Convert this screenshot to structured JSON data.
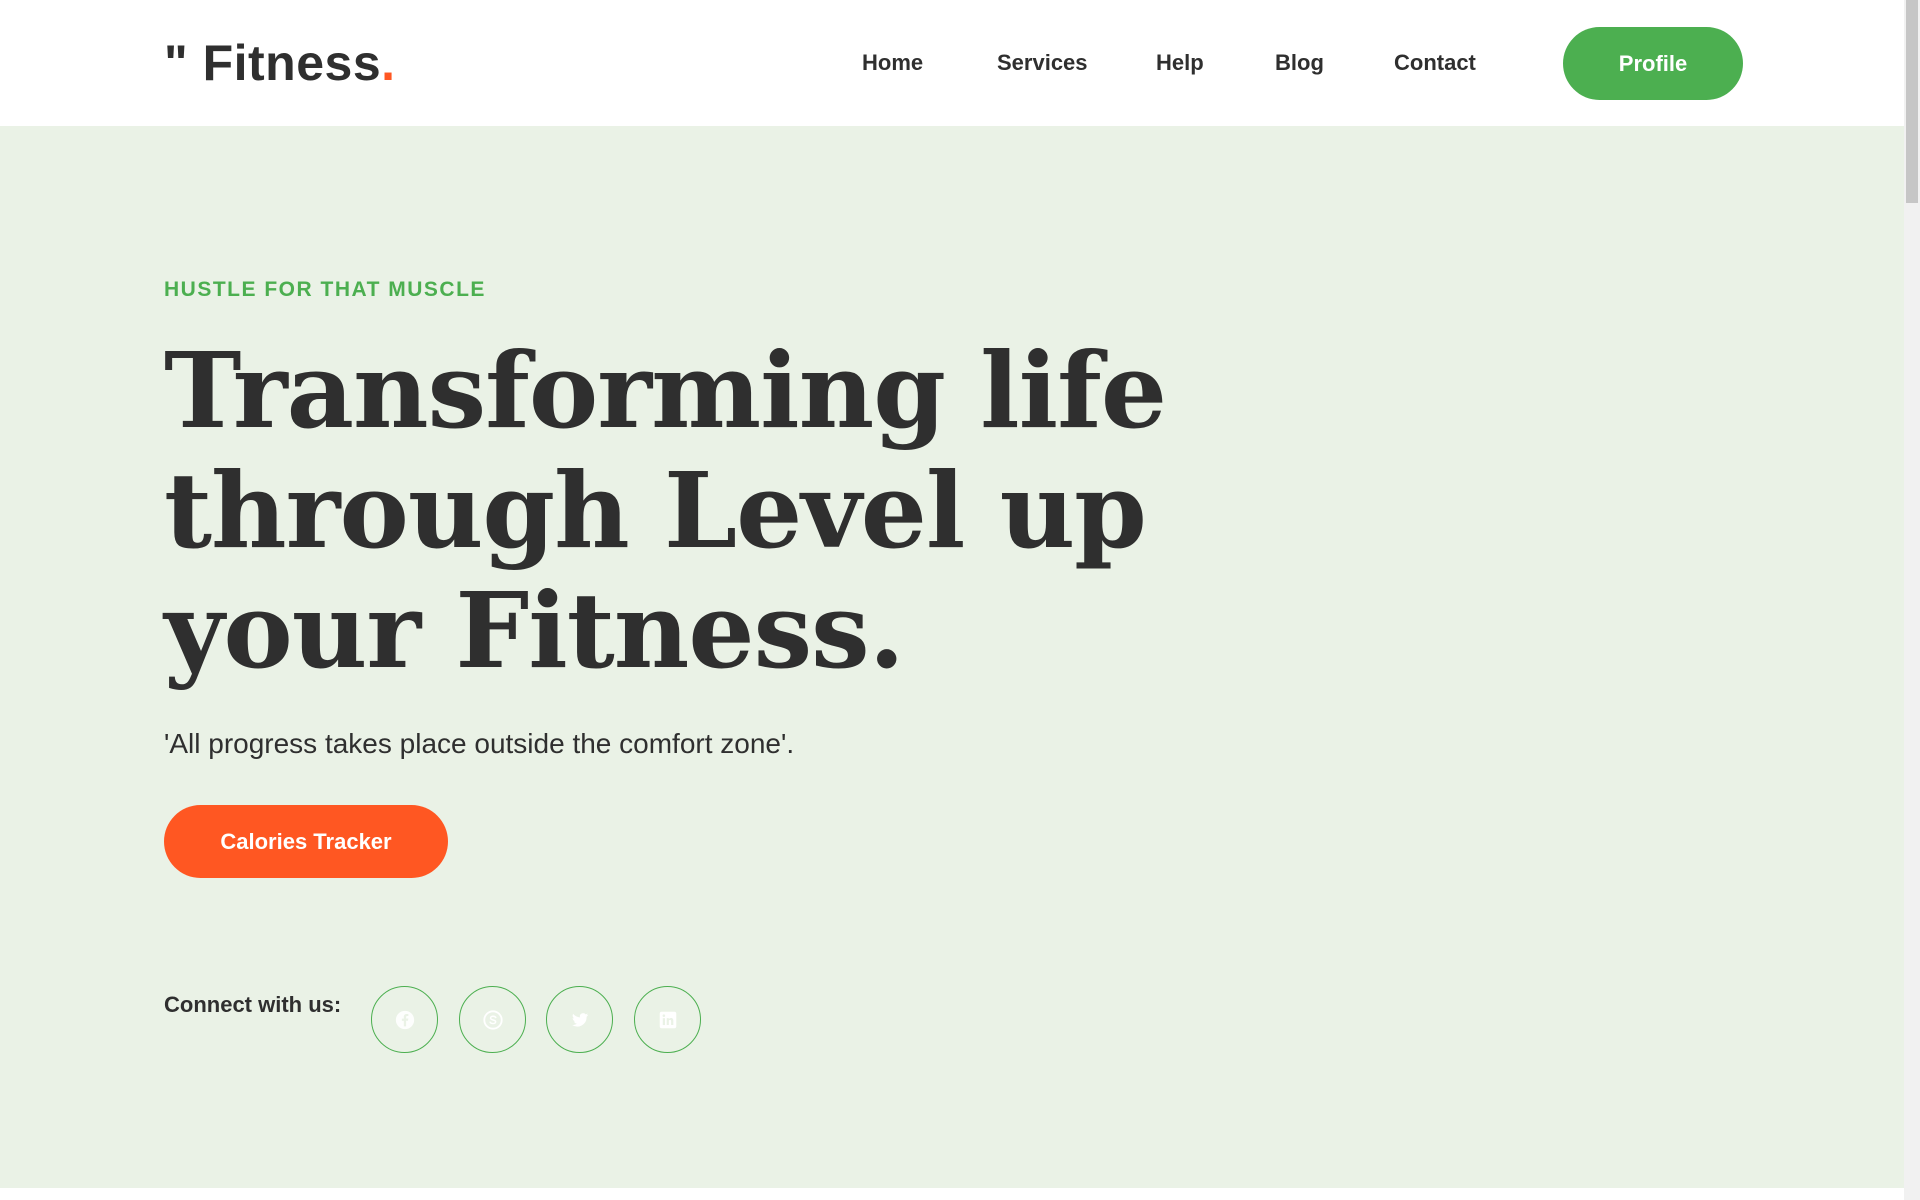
{
  "header": {
    "logo_text": "\" Fitness",
    "logo_dot": ".",
    "nav": [
      "Home",
      "Services",
      "Help",
      "Blog",
      "Contact"
    ],
    "profile_label": "Profile"
  },
  "hero": {
    "tagline": "HUSTLE FOR THAT MUSCLE",
    "headline_lines": [
      "Transforming life",
      "through Level up",
      "your Fitness."
    ],
    "quote": "'All progress takes place outside the comfort zone'.",
    "cta_label": "Calories Tracker",
    "connect_label": "Connect with us:",
    "social_icons": [
      "facebook-icon",
      "skype-icon",
      "twitter-icon",
      "linkedin-icon"
    ]
  },
  "colors": {
    "accent_green": "#4caf50",
    "accent_orange": "#ff5722",
    "hero_bg": "#eaf2e6",
    "text_dark": "#2f2f2f"
  }
}
